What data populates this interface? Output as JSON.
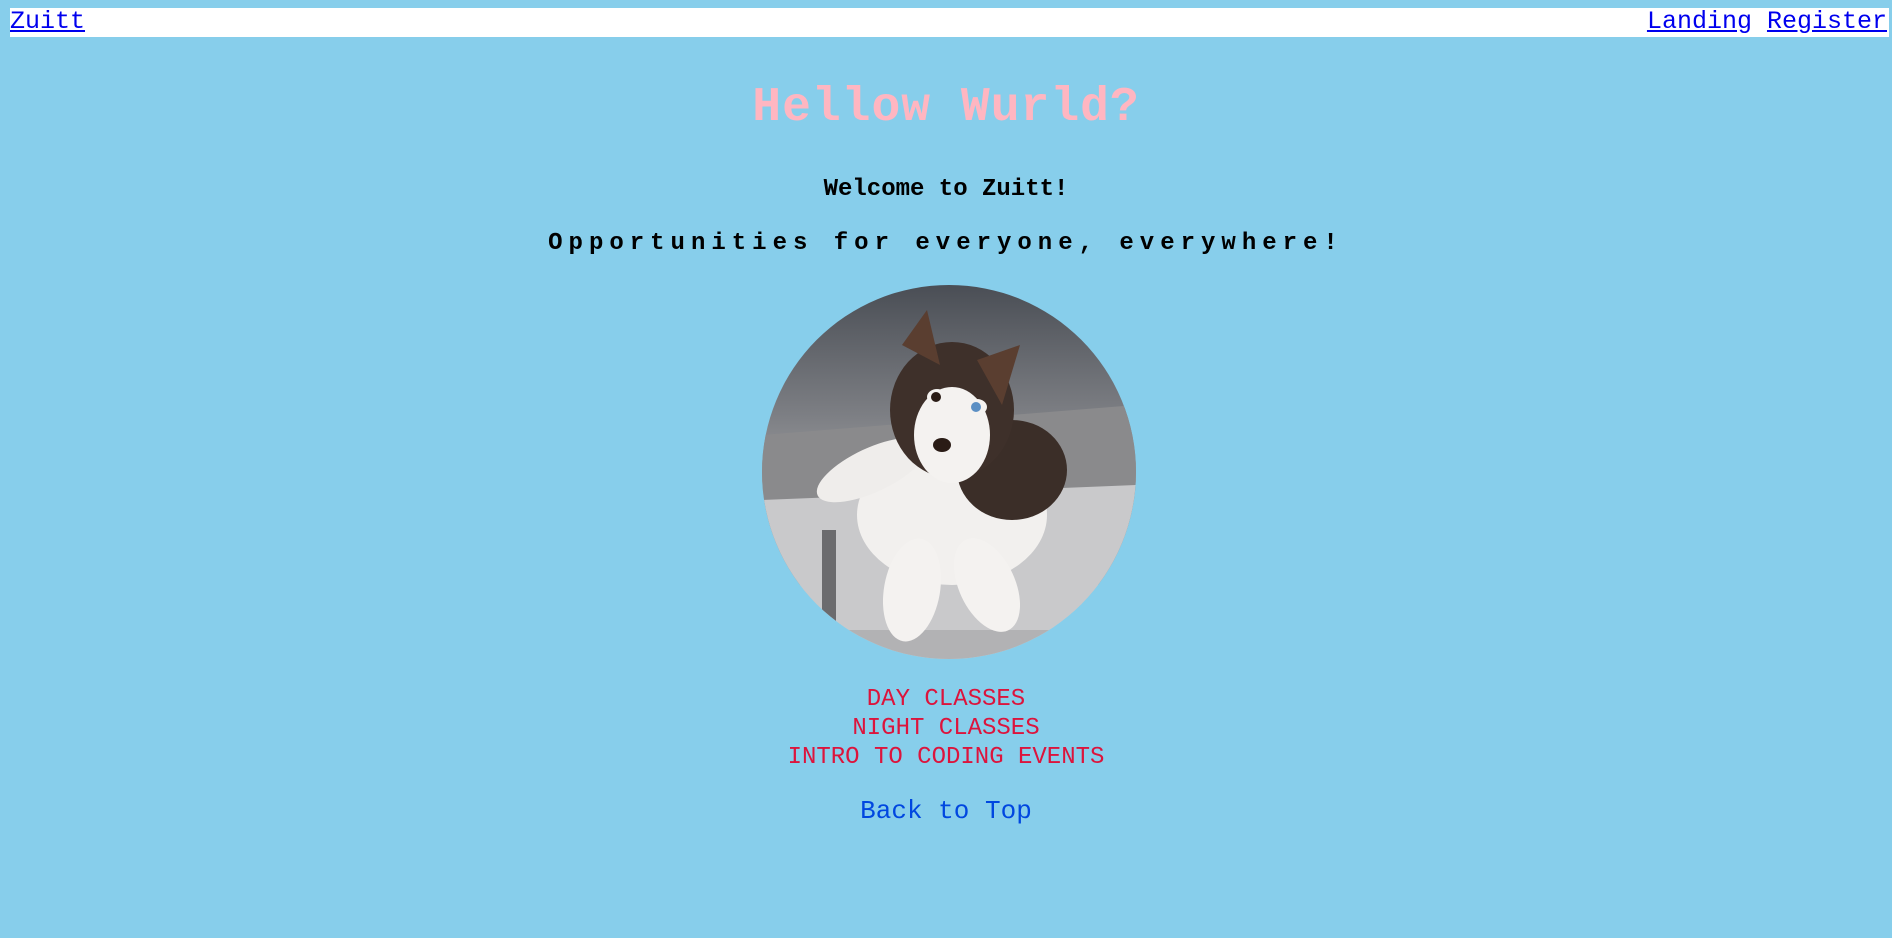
{
  "navbar": {
    "brand": "Zuitt",
    "links": [
      "Landing",
      "Register"
    ]
  },
  "hero": {
    "title": "Hellow Wurld?",
    "welcome": "Welcome to Zuitt!",
    "tagline": "Opportunities for everyone, everywhere!"
  },
  "classes": [
    "DAY CLASSES",
    "NIGHT CLASSES",
    "INTRO TO CODING EVENTS"
  ],
  "footer": {
    "back_to_top": "Back to Top"
  },
  "colors": {
    "background": "#87CEEB",
    "title": "#FFB6C1",
    "list_text": "#DC143C",
    "link": "#0000EE"
  },
  "icons": {
    "photo": "husky-puppy-photo"
  }
}
